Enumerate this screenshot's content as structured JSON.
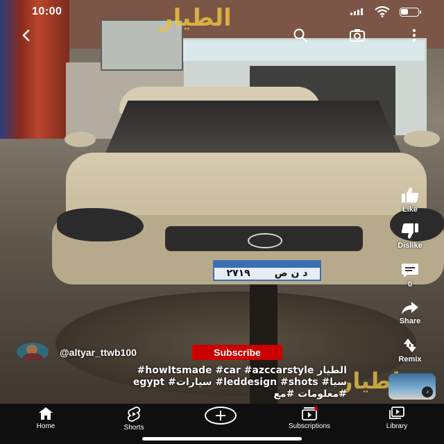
{
  "status_bar": {
    "time": "10:00"
  },
  "watermark": {
    "top": "الطيار",
    "bottom": "لطيار"
  },
  "license_plate": {
    "number": "٢٧١٩",
    "letters": "د ن ص"
  },
  "actions": {
    "like_label": "Like",
    "dislike_label": "Dislike",
    "comments_count": "0",
    "share_label": "Share",
    "remix_label": "Remix"
  },
  "channel": {
    "name": "@altyar_ttwb100",
    "subscribe_label": "Subscribe"
  },
  "caption": {
    "line1": "الطيار howItsmade #car #azccarstyle#",
    "line2": "egypt #سيارات #leddesign #shots #سيا",
    "line3": "#معلومات #مع"
  },
  "bottom_nav": {
    "home": "Home",
    "shorts": "Shorts",
    "subscriptions": "Subscriptions",
    "library": "Library"
  },
  "colors": {
    "subscribe_bg": "#cc0000",
    "nav_bg": "#0f0f0f",
    "watermark": "#e8c044"
  }
}
